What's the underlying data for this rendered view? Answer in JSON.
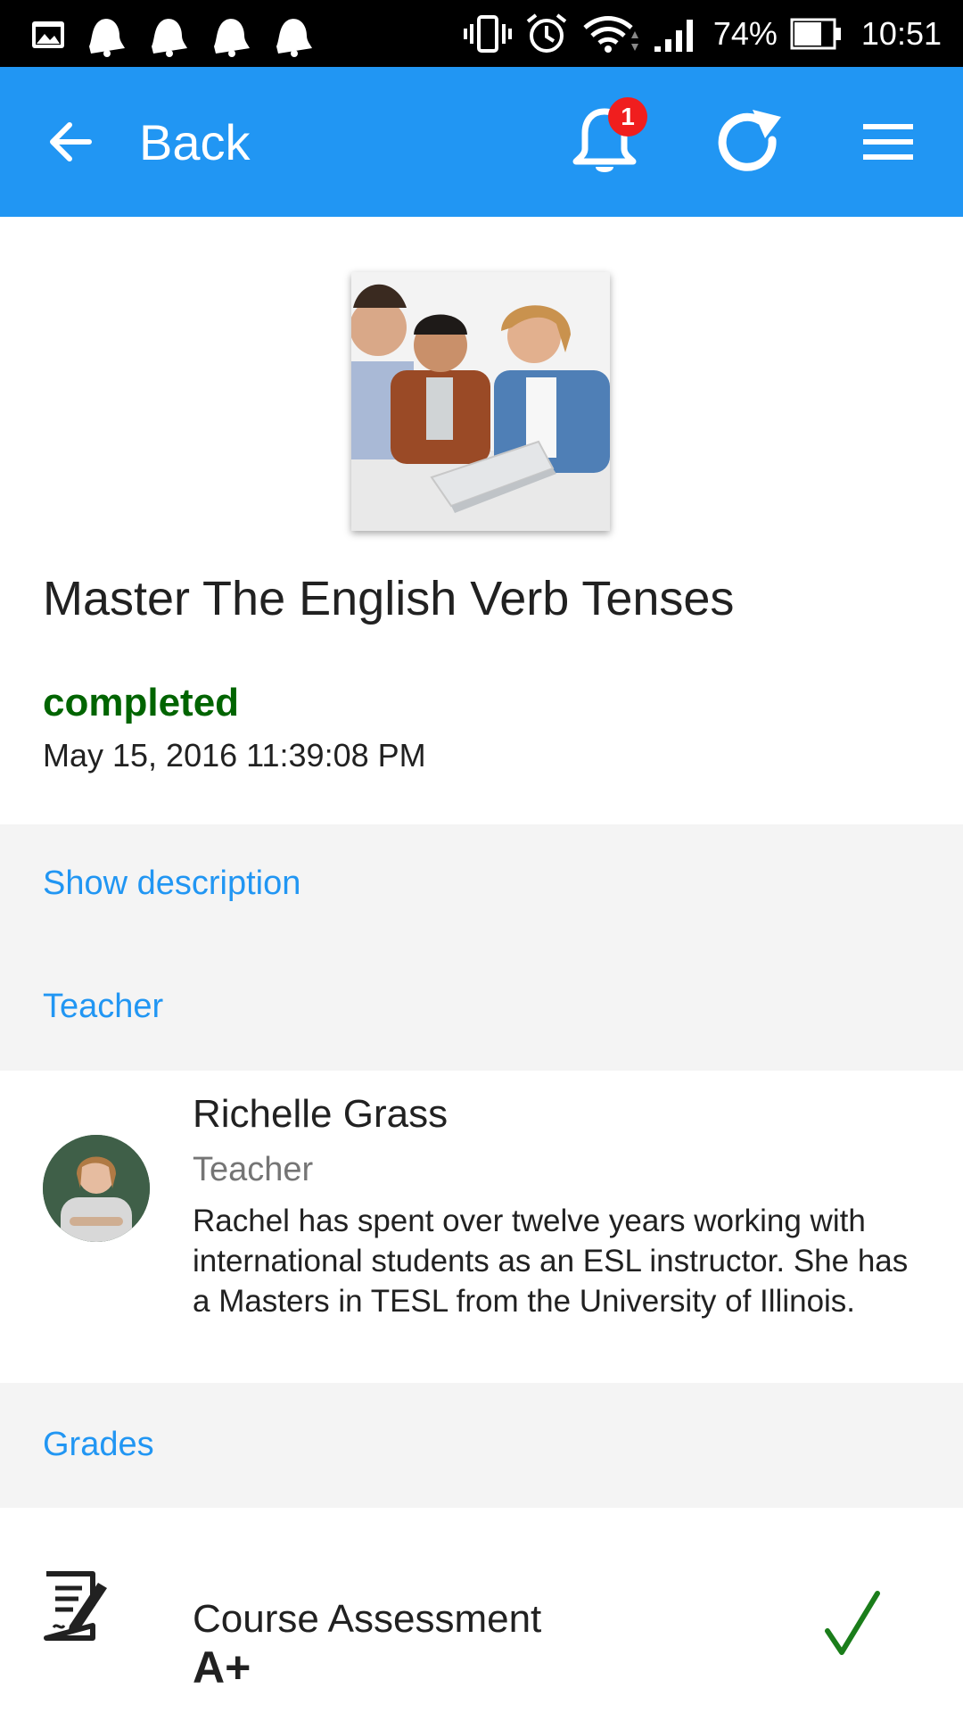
{
  "status_bar": {
    "battery_percent": "74%",
    "time": "10:51",
    "left_icons": [
      "gallery-icon",
      "notification-bell-icon",
      "notification-bell-icon",
      "notification-bell-icon",
      "notification-bell-icon"
    ],
    "right_icons": [
      "vibrate-icon",
      "alarm-icon",
      "wifi-icon",
      "signal-icon",
      "battery-icon"
    ]
  },
  "app_bar": {
    "back_label": "Back",
    "notification_count": "1",
    "background_color": "#2196f3",
    "badge_color": "#f01e1e"
  },
  "course": {
    "title": "Master The English Verb Tenses",
    "status": "completed",
    "status_color": "#006400",
    "completed_date": "May 15, 2016 11:39:08 PM"
  },
  "sections": {
    "show_description": "Show description",
    "teacher_header": "Teacher",
    "grades_header": "Grades"
  },
  "teacher": {
    "name": "Richelle Grass",
    "role": "Teacher",
    "bio": "Rachel has spent over twelve years working with international students as an ESL instructor. She has a Masters in TESL from the University of Illinois."
  },
  "grades": [
    {
      "name": "Course Assessment",
      "grade": "A+",
      "passed": true
    }
  ]
}
